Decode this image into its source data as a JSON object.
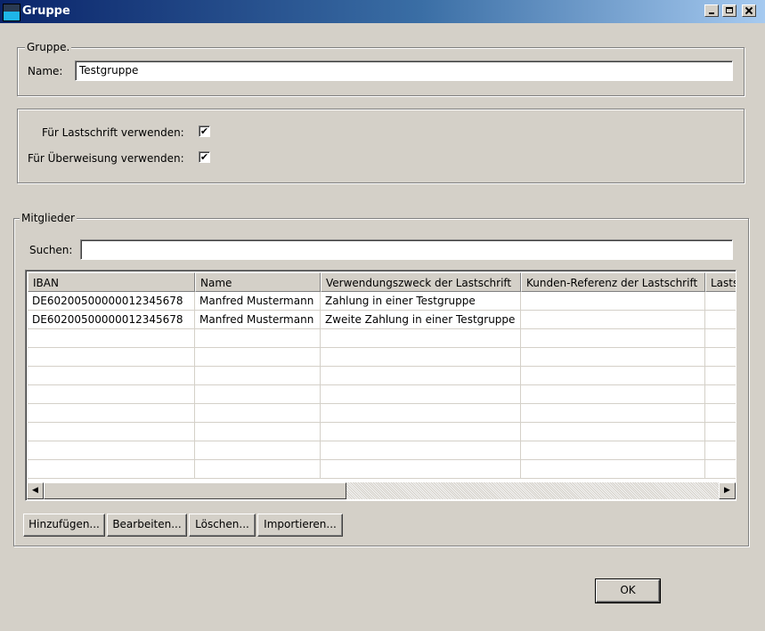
{
  "window": {
    "title": "Gruppe",
    "icons": [
      "app-icon",
      "minimize-icon",
      "maximize-icon",
      "close-icon"
    ]
  },
  "group_section": {
    "legend": "Gruppe.",
    "name_label": "Name:",
    "name_value": "Testgruppe"
  },
  "usage_section": {
    "lastschrift_label": "Für Lastschrift verwenden:",
    "lastschrift_checked": true,
    "ueberweisung_label": "Für Überweisung verwenden:",
    "ueberweisung_checked": true,
    "check_glyph": "✔"
  },
  "members_section": {
    "legend": "Mitglieder",
    "search_label": "Suchen:",
    "search_value": "",
    "columns": [
      "IBAN",
      "Name",
      "Verwendungszweck der Lastschrift",
      "Kunden-Referenz der Lastschrift",
      "Lasts"
    ],
    "rows": [
      [
        "DE60200500000012345678",
        "Manfred Mustermann",
        "Zahlung in einer Testgruppe",
        "",
        ""
      ],
      [
        "DE60200500000012345678",
        "Manfred Mustermann",
        "Zweite Zahlung in einer Testgruppe",
        "",
        ""
      ]
    ],
    "scroll_left": "◀",
    "scroll_right": "▶"
  },
  "buttons": {
    "add": "Hinzufügen...",
    "edit": "Bearbeiten...",
    "delete": "Löschen...",
    "import": "Importieren...",
    "ok": "OK"
  }
}
